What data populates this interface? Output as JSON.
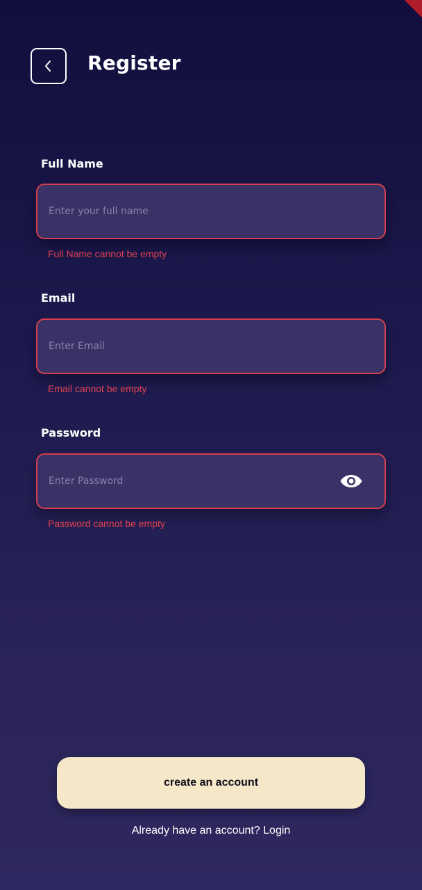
{
  "header": {
    "title": "Register",
    "back_icon": "chevron-left-icon"
  },
  "form": {
    "full_name": {
      "label": "Full Name",
      "placeholder": "Enter your full name",
      "value": "",
      "error": "Full Name cannot be empty"
    },
    "email": {
      "label": "Email",
      "placeholder": "Enter Email",
      "value": "",
      "error": "Email cannot be empty"
    },
    "password": {
      "label": "Password",
      "placeholder": "Enter Password",
      "value": "",
      "error": "Password cannot be empty",
      "toggle_icon": "eye-icon"
    }
  },
  "actions": {
    "create_label": "create an account",
    "login_prompt": "Already have an account? Login"
  },
  "colors": {
    "background_top": "#120e3d",
    "background_bottom": "#2e2860",
    "field_fill": "#3a3166",
    "error": "#e0414f",
    "button_fill": "#f5e8c8",
    "debug_banner": "#b11d2a"
  }
}
